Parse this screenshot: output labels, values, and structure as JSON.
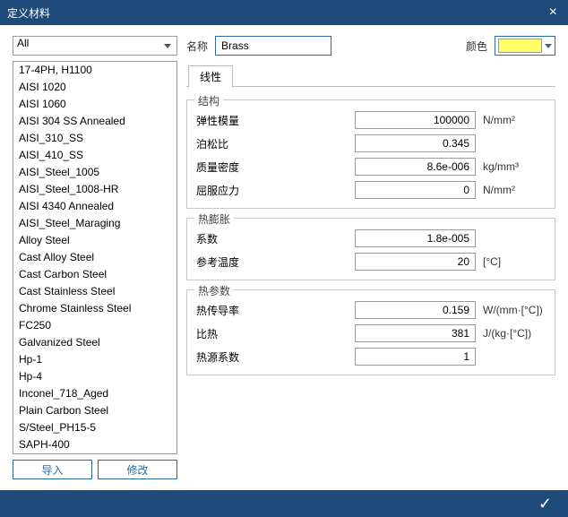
{
  "title": "定义材料",
  "filter": {
    "value": "All"
  },
  "materials": [
    "17-4PH, H1100",
    "AISI 1020",
    "AISI 1060",
    "AISI 304 SS Annealed",
    "AISI_310_SS",
    "AISI_410_SS",
    "AISI_Steel_1005",
    "AISI_Steel_1008-HR",
    "AISI 4340 Annealed",
    "AISI_Steel_Maraging",
    "Alloy Steel",
    "Cast Alloy Steel",
    "Cast Carbon Steel",
    "Cast Stainless Steel",
    "Chrome Stainless Steel",
    "FC250",
    "Galvanized Steel",
    "Hp-1",
    "Hp-4",
    "Inconel_718_Aged",
    "Plain Carbon Steel",
    "S/Steel_PH15-5",
    "SAPH-400"
  ],
  "buttons": {
    "import": "导入",
    "modify": "修改"
  },
  "name_label": "名称",
  "name_value": "Brass",
  "color_label": "颜色",
  "color_value": "#ffff6a",
  "tab_linear": "线性",
  "groups": {
    "structural": {
      "legend": "结构",
      "elastic_modulus_label": "弹性模量",
      "elastic_modulus_value": "100000",
      "elastic_modulus_unit": "N/mm²",
      "poisson_label": "泊松比",
      "poisson_value": "0.345",
      "poisson_unit": "",
      "density_label": "质量密度",
      "density_value": "8.6e-006",
      "density_unit": "kg/mm³",
      "yield_label": "屈服应力",
      "yield_value": "0",
      "yield_unit": "N/mm²"
    },
    "thermal_expansion": {
      "legend": "热膨胀",
      "coef_label": "系数",
      "coef_value": "1.8e-005",
      "coef_unit": "",
      "ref_temp_label": "参考温度",
      "ref_temp_value": "20",
      "ref_temp_unit": "[°C]"
    },
    "thermal_params": {
      "legend": "热参数",
      "conductivity_label": "热传导率",
      "conductivity_value": "0.159",
      "conductivity_unit": "W/(mm·[°C])",
      "spec_heat_label": "比热",
      "spec_heat_value": "381",
      "spec_heat_unit": "J/(kg·[°C])",
      "heat_source_label": "热源系数",
      "heat_source_value": "1",
      "heat_source_unit": ""
    }
  }
}
